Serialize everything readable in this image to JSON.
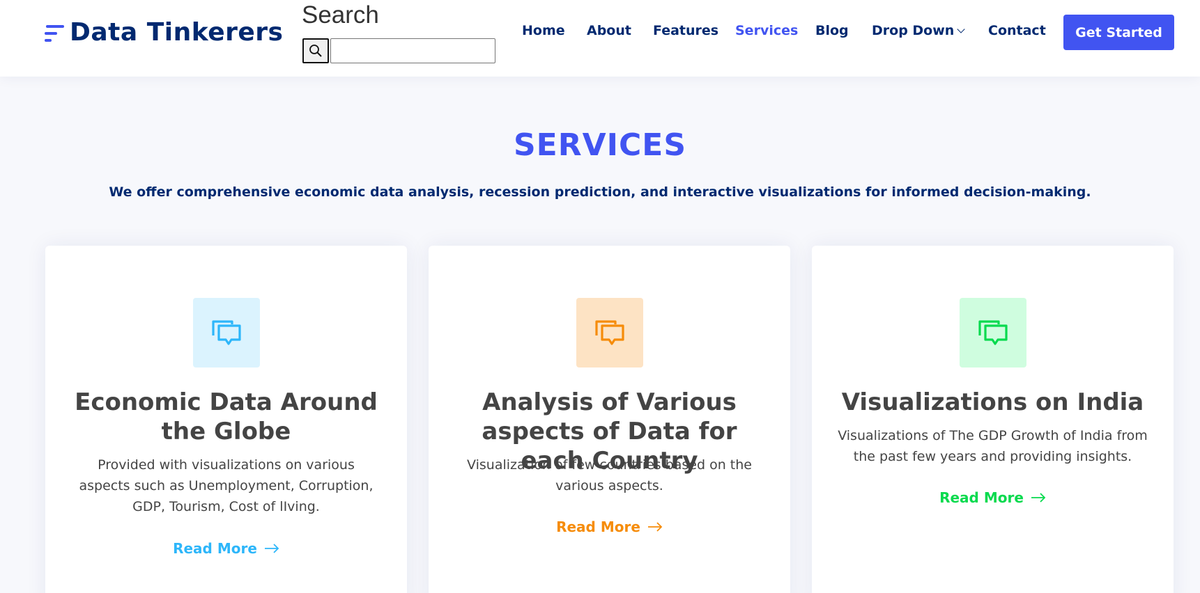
{
  "brand": {
    "name": "Data Tinkerers"
  },
  "search": {
    "label": "Search",
    "value": "",
    "placeholder": ""
  },
  "nav": {
    "items": [
      {
        "label": "Home"
      },
      {
        "label": "About"
      },
      {
        "label": "Features"
      },
      {
        "label": "Services",
        "active": true
      },
      {
        "label": "Blog"
      },
      {
        "label": "Drop Down"
      },
      {
        "label": "Contact"
      }
    ],
    "cta": "Get Started"
  },
  "section": {
    "title": "SERVICES",
    "subtitle": "We offer comprehensive economic data analysis, recession prediction, and interactive visualizations for informed decision-making."
  },
  "cards": [
    {
      "title": "Economic Data Around the Globe",
      "text": "Provided with visualizations on various aspects such as Unemployment, Corruption, GDP, Tourism, Cost of lIving.",
      "link": "Read More",
      "icon": "chat-icon",
      "accent": "#2db6fa",
      "icon_bg": "#dbf3fe"
    },
    {
      "title": "Analysis of Various aspects of Data for each Country",
      "text": "Visualization of few countries based on the various aspects.",
      "link": "Read More",
      "icon": "chat-icon",
      "accent": "#f68c09",
      "icon_bg": "#fde3c4"
    },
    {
      "title": "Visualizations on India",
      "text": "Visualizations of The GDP Growth of India from the past few years and providing insights.",
      "link": "Read More",
      "icon": "chat-icon",
      "accent": "#08da4e",
      "icon_bg": "#cffddf"
    }
  ],
  "colors": {
    "primary": "#4154f1",
    "navy": "#012970"
  }
}
